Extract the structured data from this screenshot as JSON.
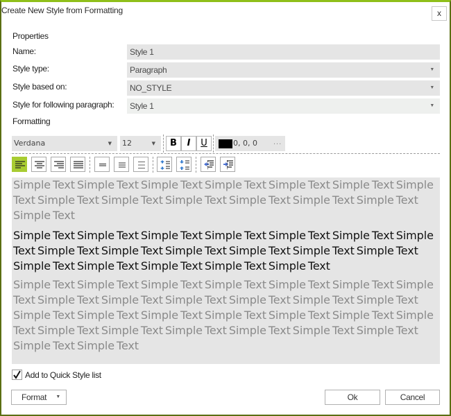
{
  "window": {
    "title": "Create New Style from Formatting",
    "close_label": "x",
    "accent_color": "#8fbf1a",
    "border_color": "#5a6e12"
  },
  "properties": {
    "section_label": "Properties",
    "name_label": "Name:",
    "name_value": "Style 1",
    "style_type_label": "Style type:",
    "style_type_value": "Paragraph",
    "based_on_label": "Style based on:",
    "based_on_value": "NO_STYLE",
    "following_label": "Style for following paragraph:",
    "following_value": "Style 1"
  },
  "formatting": {
    "section_label": "Formatting",
    "font_family": "Verdana",
    "font_size": "12",
    "bold_label": "B",
    "italic_label": "I",
    "underline_label": "U",
    "color_value": "0, 0, 0",
    "color_swatch": "#000000",
    "more_label": "...",
    "dropdown_arrow": "▼",
    "paragraph_buttons": [
      {
        "name": "align-left",
        "active": true
      },
      {
        "name": "align-center",
        "active": false
      },
      {
        "name": "align-right",
        "active": false
      },
      {
        "name": "align-justify",
        "active": false
      },
      {
        "name": "line-spacing-single",
        "active": false
      },
      {
        "name": "line-spacing-one-half",
        "active": false
      },
      {
        "name": "line-spacing-double",
        "active": false
      },
      {
        "name": "increase-paragraph-spacing",
        "active": false
      },
      {
        "name": "decrease-paragraph-spacing",
        "active": false
      },
      {
        "name": "decrease-indent",
        "active": false
      },
      {
        "name": "increase-indent",
        "active": false
      }
    ]
  },
  "preview": {
    "previous_paragraph": "Simple Text Simple Text Simple Text Simple Text Simple Text Simple Text Simple Text Simple Text Simple Text Simple Text Simple Text Simple Text Simple Text Simple Text",
    "current_paragraph": "Simple Text Simple Text Simple Text Simple Text Simple Text Simple Text Simple Text Simple Text Simple Text Simple Text Simple Text Simple Text Simple Text Simple Text Simple Text Simple Text Simple Text Simple Text",
    "following_paragraph": "Simple Text Simple Text Simple Text Simple Text Simple Text Simple Text Simple Text Simple Text Simple Text Simple Text Simple Text Simple Text Simple Text Simple Text Simple Text Simple Text Simple Text Simple Text Simple Text Simple Text Simple Text Simple Text Simple Text Simple Text Simple Text Simple Text Simple Text Simple Text"
  },
  "footer": {
    "quick_style_label": "Add to Quick Style list",
    "quick_style_checked": true,
    "format_label": "Format",
    "ok_label": "Ok",
    "cancel_label": "Cancel"
  }
}
